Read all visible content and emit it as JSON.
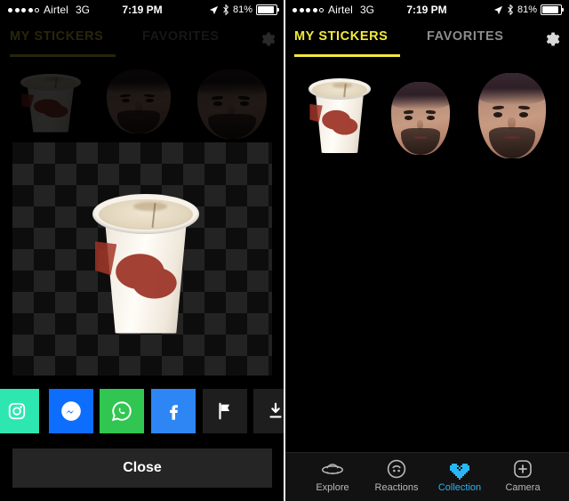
{
  "status_bar": {
    "signal_dots_filled": 4,
    "signal_dots_total": 5,
    "carrier": "Airtel",
    "network": "3G",
    "time": "7:19 PM",
    "battery_percent": "81%",
    "location_icon": "location-arrow-icon",
    "bluetooth_icon": "bluetooth-icon",
    "battery_icon": "battery-icon"
  },
  "header": {
    "tabs": [
      {
        "label": "MY STICKERS",
        "active": true
      },
      {
        "label": "FAVORITES",
        "active": false
      }
    ],
    "settings_icon": "gear-icon",
    "accent_color": "#f3e93c"
  },
  "left_panel": {
    "state": "sticker-detail-modal-open",
    "thumbnails": [
      {
        "name": "paper-cup-sticker",
        "type": "cup"
      },
      {
        "name": "face-sticker-1",
        "type": "face"
      },
      {
        "name": "face-sticker-2",
        "type": "face"
      }
    ],
    "preview": {
      "name": "sticker-preview",
      "background": "transparency-checkerboard",
      "sticker": "paper-cup-sticker"
    },
    "share_buttons": [
      {
        "name": "share-instagram",
        "icon": "instagram-icon",
        "color": "#2ee6b0",
        "clipped": true
      },
      {
        "name": "share-messenger",
        "icon": "messenger-icon",
        "color": "#0d6efd"
      },
      {
        "name": "share-whatsapp",
        "icon": "whatsapp-icon",
        "color": "#31c651"
      },
      {
        "name": "share-facebook",
        "icon": "facebook-icon",
        "color": "#2e86f5"
      },
      {
        "name": "report-sticker",
        "icon": "flag-icon",
        "color": "#1e1e1e"
      },
      {
        "name": "download-sticker",
        "icon": "download-icon",
        "color": "#1e1e1e"
      }
    ],
    "close_label": "Close"
  },
  "right_panel": {
    "state": "collection-grid",
    "stickers": [
      {
        "name": "paper-cup-sticker",
        "type": "cup"
      },
      {
        "name": "face-sticker-1",
        "type": "face"
      },
      {
        "name": "face-sticker-2",
        "type": "face"
      }
    ]
  },
  "tabbar": {
    "active_color": "#29b6f6",
    "items": [
      {
        "label": "Explore",
        "icon": "ufo-icon",
        "active": false
      },
      {
        "label": "Reactions",
        "icon": "smiley-icon",
        "active": false
      },
      {
        "label": "Collection",
        "icon": "pixel-heart-icon",
        "active": true
      },
      {
        "label": "Camera",
        "icon": "plus-square-icon",
        "active": false
      }
    ]
  }
}
